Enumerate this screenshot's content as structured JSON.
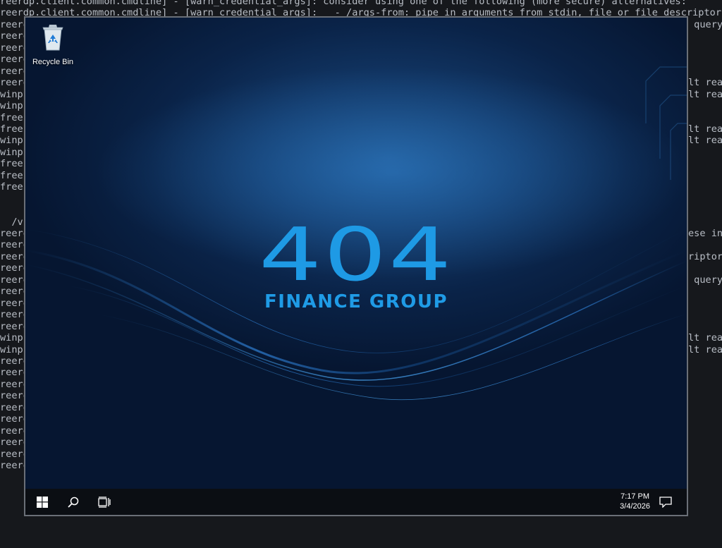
{
  "terminal": {
    "lines": [
      "reerdp.client.common.cmdline] - [warn_credential_args]: consider using one of the following (more secure) alternatives:",
      "reerdp.client.common.cmdline] - [warn_credential_args]:   - /args-from: pipe in arguments from stdin, file or file descriptor",
      "reero",
      "reero",
      "reero",
      "reero",
      "reero",
      "reero",
      "winpr",
      "winpr",
      "freer",
      "freer",
      "winpr",
      "winpr",
      "freer",
      "freer",
      "freer",
      "",
      "",
      "  /v:",
      "reero",
      "reero",
      "reero",
      "reero",
      "reero",
      "reero",
      "reero",
      "reero",
      "reero",
      "winpr",
      "winpr",
      "reero",
      "reero",
      "reero",
      "reero",
      "reero",
      "reero",
      "reero",
      "reero",
      "reero",
      "reero"
    ],
    "right_fragments": [
      {
        "row": 2,
        "text": " query"
      },
      {
        "row": 7,
        "text": "lt rea"
      },
      {
        "row": 8,
        "text": "lt rea"
      },
      {
        "row": 11,
        "text": "lt rea"
      },
      {
        "row": 12,
        "text": "lt rea"
      },
      {
        "row": 20,
        "text": "ese in"
      },
      {
        "row": 22,
        "text": "riptor"
      },
      {
        "row": 24,
        "text": " query"
      },
      {
        "row": 29,
        "text": "lt rea"
      },
      {
        "row": 30,
        "text": "lt rea"
      }
    ]
  },
  "desktop": {
    "recycle_bin_label": "Recycle Bin",
    "logo_number": "404",
    "logo_subtitle": "FINANCE GROUP"
  },
  "taskbar": {
    "time": "7:17 PM",
    "date": "3/4/2026",
    "icons": [
      "windows-start-icon",
      "search-icon",
      "task-view-icon",
      "notification-icon"
    ]
  },
  "colors": {
    "terminal_bg": "#16181c",
    "terminal_text": "#b9bec6",
    "logo_blue": "#1f9be6",
    "taskbar_bg": "#0b0e13",
    "desktop_bg": "#0a2348"
  }
}
